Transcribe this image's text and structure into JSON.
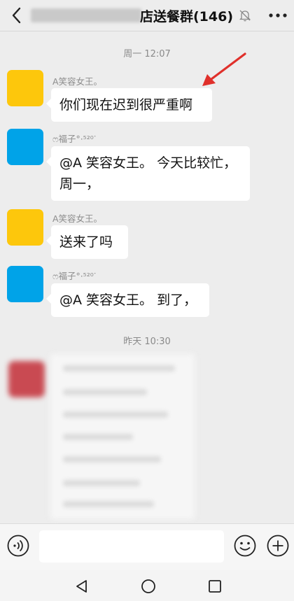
{
  "header": {
    "title": "店送餐群(146)",
    "icons": {
      "back": "back-arrow-icon",
      "mute": "bell-muted-icon",
      "more": "more-dots-icon"
    }
  },
  "messages": {
    "time1": "周一 12:07",
    "m1": {
      "sender": "A笑容女王。",
      "text": "你们现在迟到很严重啊",
      "avatar_color": "#fdc70c"
    },
    "m2": {
      "sender": "ෆ福子°·⁵²⁰ᐝ",
      "line1": "@A 笑容女王。  今天比较忙，",
      "line2": "周一，",
      "avatar_color": "#00a3e8"
    },
    "m3": {
      "sender": "A笑容女王。",
      "text": "送来了吗",
      "avatar_color": "#fdc70c"
    },
    "m4": {
      "sender": "ෆ福子°·⁵²⁰ᐝ",
      "text": "@A 笑容女王。 到了，",
      "avatar_color": "#00a3e8"
    },
    "time2": "昨天 10:30"
  },
  "annotation": {
    "arrow_color": "#e0302b"
  },
  "input_bar": {
    "icons": [
      "voice-icon",
      "emoji-icon",
      "plus-icon"
    ]
  },
  "navbar": {
    "icons": [
      "nav-back-icon",
      "nav-home-icon",
      "nav-recent-icon"
    ]
  }
}
